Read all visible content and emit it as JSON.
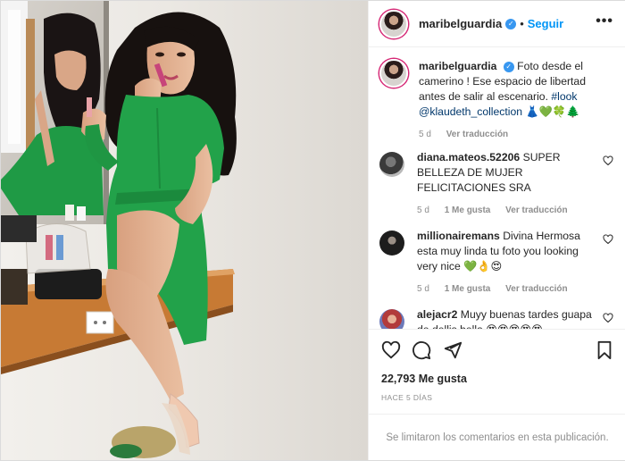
{
  "post": {
    "username": "maribelguardia",
    "verified_icon": "verified-badge-icon",
    "dot": "•",
    "follow_label": "Seguir",
    "more_label": "•••"
  },
  "caption": {
    "username": "maribelguardia",
    "text": "Foto desde el camerino ! Ese espacio de libertad antes de salir al escenario.",
    "hashtag": "#look",
    "mention": "@klaudeth_collection",
    "emojis": "👗💚🍀🌲",
    "time": "5 d",
    "translate_label": "Ver traducción"
  },
  "comments": [
    {
      "username": "diana.mateos.52206",
      "text": "SUPER BELLEZA DE MUJER FELICITACIONES SRA",
      "time": "5 d",
      "likes": "1 Me gusta",
      "translate_label": "Ver traducción"
    },
    {
      "username": "millionairemans",
      "text": "Divina Hermosa esta muy linda tu foto you looking very nice",
      "emojis": "💚👌😍",
      "time": "5 d",
      "likes": "1 Me gusta",
      "translate_label": "Ver traducción"
    },
    {
      "username": "alejacr2",
      "text": "Muyy buenas tardes",
      "text_cut": "guapa de dellis bella",
      "emojis": "😍😍😍😍😍"
    }
  ],
  "actions": {
    "icons": [
      "heart-icon",
      "comment-icon",
      "share-icon",
      "bookmark-icon"
    ],
    "likes_count": "22,793",
    "likes_label": "Me gusta",
    "time_ago": "HACE 5 DÍAS",
    "comments_limited": "Se limitaron los comentarios en esta publicación."
  },
  "colors": {
    "link": "#0095f6",
    "text": "#262626",
    "muted": "#8e8e8e",
    "dress": "#22a24a",
    "wood": "#c77a34"
  }
}
